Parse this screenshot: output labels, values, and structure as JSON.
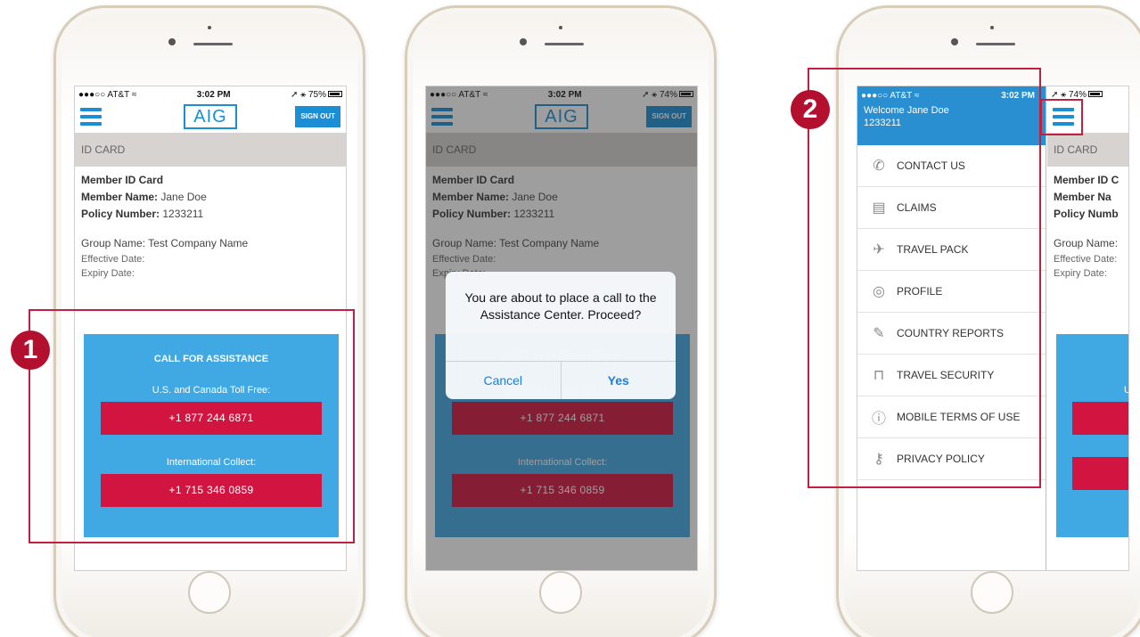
{
  "status": {
    "carrier": "●●●○○ AT&T",
    "wifi": "≈",
    "time": "3:02 PM",
    "battery1": "75%",
    "battery2": "74%",
    "battery3": "74%",
    "location": "➚ ⚹"
  },
  "appbar": {
    "logo": "AIG",
    "signout": "SIGN OUT"
  },
  "section_title": "ID CARD",
  "card": {
    "member_id_card": "Member ID Card",
    "member_name_label": "Member Name:",
    "member_name_value": "Jane Doe",
    "policy_label": "Policy Number:",
    "policy_value": "1233211",
    "group_label": "Group Name:",
    "group_value": "Test Company Name",
    "effective_label": "Effective Date:",
    "expiry_label": "Expiry Date:"
  },
  "call": {
    "title": "CALL FOR ASSISTANCE",
    "us_label": "U.S. and Canada Toll Free:",
    "us_number": "+1 877 244 6871",
    "intl_label": "International Collect:",
    "intl_number": "+1 715 346 0859"
  },
  "dialog": {
    "message": "You are about to place a call to the Assistance Center. Proceed?",
    "cancel": "Cancel",
    "yes": "Yes"
  },
  "menu": {
    "welcome": "Welcome Jane Doe",
    "member_id": "1233211",
    "items": [
      {
        "label": "CONTACT US",
        "icon": "phone-icon"
      },
      {
        "label": "CLAIMS",
        "icon": "claims-icon"
      },
      {
        "label": "TRAVEL PACK",
        "icon": "plane-icon"
      },
      {
        "label": "PROFILE",
        "icon": "profile-icon"
      },
      {
        "label": "COUNTRY REPORTS",
        "icon": "pencil-icon"
      },
      {
        "label": "TRAVEL SECURITY",
        "icon": "lock-icon"
      },
      {
        "label": "MOBILE TERMS OF USE",
        "icon": "info-icon"
      },
      {
        "label": "PRIVACY POLICY",
        "icon": "key-icon"
      }
    ]
  },
  "peek": {
    "member_id_card": "Member ID C",
    "member_name_label": "Member Na",
    "policy_label": "Policy Numb",
    "group_label": "Group Name:",
    "effective_label": "Effective Date:",
    "expiry_label": "Expiry Date:",
    "call_title": "CA",
    "us_label": "U."
  },
  "badges": {
    "one": "1",
    "two": "2"
  },
  "colors": {
    "accent": "#1a8fd6",
    "call_panel": "#40a8e2",
    "call_button": "#d11540",
    "highlight": "#c1203e"
  }
}
